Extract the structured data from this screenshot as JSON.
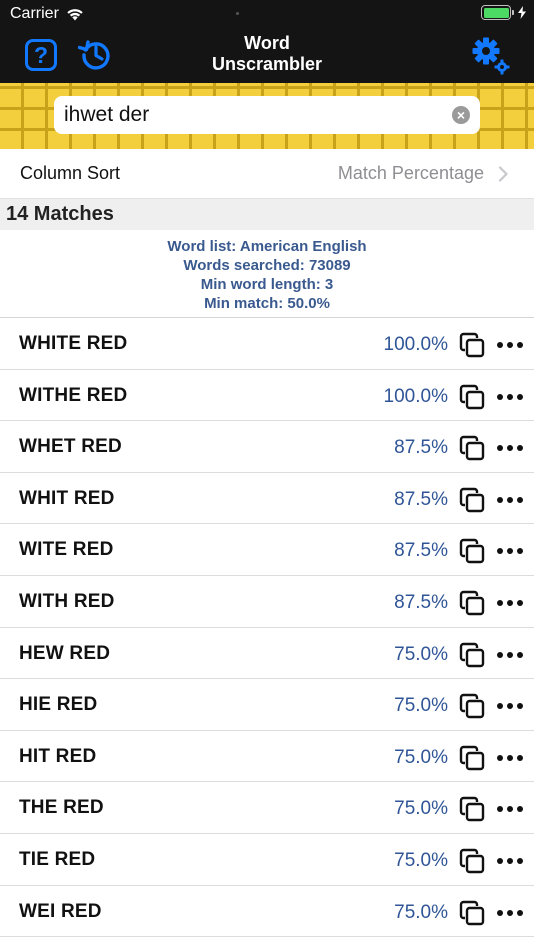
{
  "status_bar": {
    "carrier": "Carrier"
  },
  "nav": {
    "title_line1": "Word",
    "title_line2": "Unscrambler",
    "help_label": "?",
    "accent_color": "#1279ff"
  },
  "search": {
    "value": "ihwet der",
    "clear_label": "×"
  },
  "sort": {
    "label": "Column Sort",
    "value": "Match Percentage"
  },
  "matches": {
    "header": "14 Matches"
  },
  "info": {
    "word_list": "Word list: American English",
    "words_searched": "Words searched: 73089",
    "min_word_length": "Min word length: 3",
    "min_match": "Min match: 50.0%"
  },
  "results": [
    {
      "word": "WHITE RED",
      "pct": "100.0%"
    },
    {
      "word": "WITHE RED",
      "pct": "100.0%"
    },
    {
      "word": "WHET RED",
      "pct": "87.5%"
    },
    {
      "word": "WHIT RED",
      "pct": "87.5%"
    },
    {
      "word": "WITE RED",
      "pct": "87.5%"
    },
    {
      "word": "WITH RED",
      "pct": "87.5%"
    },
    {
      "word": "HEW RED",
      "pct": "75.0%"
    },
    {
      "word": "HIE RED",
      "pct": "75.0%"
    },
    {
      "word": "HIT RED",
      "pct": "75.0%"
    },
    {
      "word": "THE RED",
      "pct": "75.0%"
    },
    {
      "word": "TIE RED",
      "pct": "75.0%"
    },
    {
      "word": "WEI RED",
      "pct": "75.0%"
    }
  ],
  "icons": {
    "help": "help-icon",
    "history": "history-icon",
    "settings": "gear-icon",
    "copy": "copy-icon",
    "more": "more-icon"
  }
}
